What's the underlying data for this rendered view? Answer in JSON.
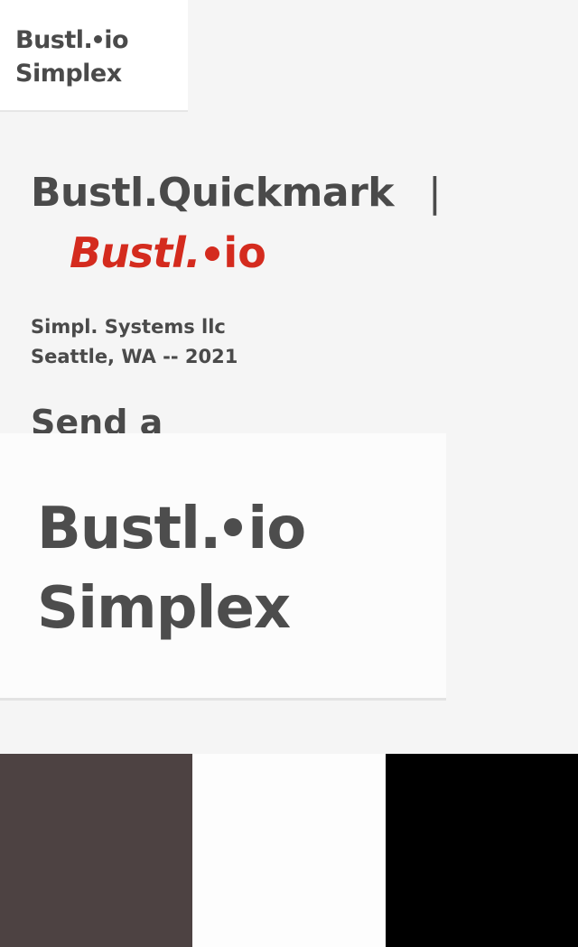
{
  "logo": {
    "line1_a": "Bustl.",
    "line1_b": "io",
    "line2": "Simplex"
  },
  "main": {
    "heading": "Bustl.Quickmark",
    "separator": "|",
    "brand_italic": "Bustl.",
    "brand_io": "io",
    "subtitle": "Simpl. Systems llc Seattle, WA -- 2021",
    "send_heading": "Send a"
  },
  "overlay": {
    "line1_a": "Bustl.",
    "line1_b": "io",
    "line2": "Simplex"
  },
  "swatches": [
    {
      "name": "dark-brown",
      "color": "#4d4242"
    },
    {
      "name": "white",
      "color": "#fdfdfd"
    },
    {
      "name": "black",
      "color": "#000000"
    }
  ],
  "colors": {
    "brand_red": "#d42b1e",
    "text_gray": "#4a4a4a",
    "background": "#f5f5f5"
  }
}
